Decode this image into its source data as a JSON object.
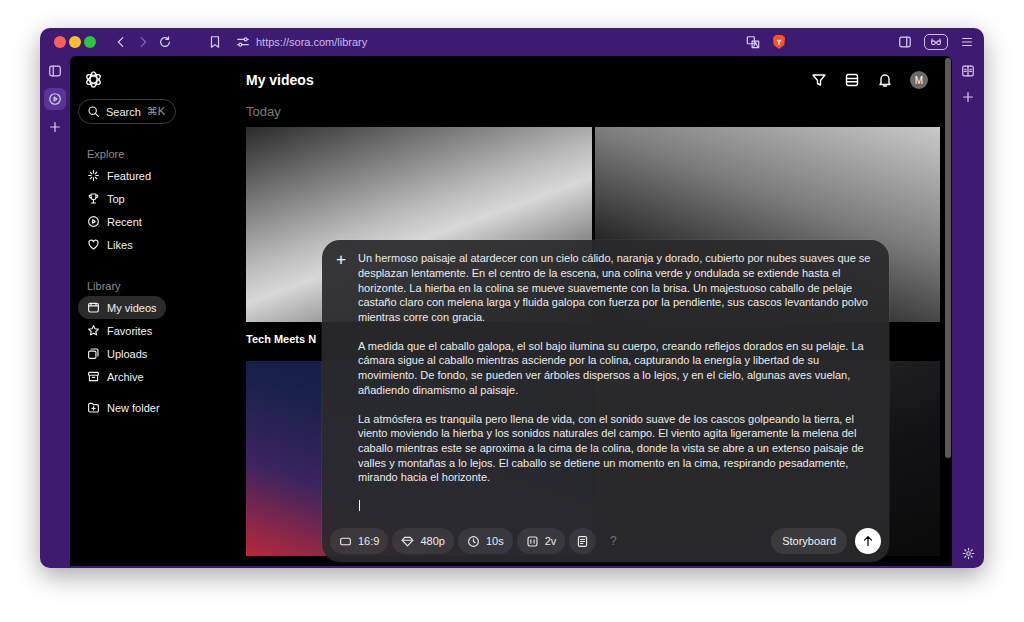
{
  "browser": {
    "url": "https://sora.com/library",
    "pinned_tabs": [
      {
        "selected": true
      }
    ]
  },
  "sidebar": {
    "search": {
      "label": "Search",
      "shortcut": "⌘K"
    },
    "sections": [
      {
        "title": "Explore",
        "items": [
          {
            "label": "Featured",
            "selected": false
          },
          {
            "label": "Top",
            "selected": false
          },
          {
            "label": "Recent",
            "selected": false
          },
          {
            "label": "Likes",
            "selected": false
          }
        ]
      },
      {
        "title": "Library",
        "items": [
          {
            "label": "My videos",
            "selected": true
          },
          {
            "label": "Favorites",
            "selected": false
          },
          {
            "label": "Uploads",
            "selected": false
          },
          {
            "label": "Archive",
            "selected": false
          }
        ]
      }
    ],
    "new_folder": "New folder"
  },
  "header": {
    "title": "My videos",
    "avatar": "M"
  },
  "today": "Today",
  "collection": "Tech Meets N",
  "prompt": {
    "add": "+",
    "paragraphs": [
      "Un hermoso paisaje al atardecer con un cielo cálido, naranja y dorado, cubierto por nubes suaves que se desplazan lentamente. En el centro de la escena, una colina verde y ondulada se extiende hasta el horizonte. La hierba en la colina se mueve suavemente con la brisa. Un majestuoso caballo de pelaje castaño claro con melena larga y fluida galopa con fuerza por la pendiente, sus cascos levantando polvo mientras corre con gracia.",
      "A medida que el caballo galopa, el sol bajo ilumina su cuerpo, creando reflejos dorados en su pelaje. La cámara sigue al caballo mientras asciende por la colina, capturando la energía y libertad de su movimiento. De fondo, se pueden ver árboles dispersos a lo lejos, y en el cielo, algunas aves vuelan, añadiendo dinamismo al paisaje.",
      "La atmósfera es tranquila pero llena de vida, con el sonido suave de los cascos golpeando la tierra, el viento moviendo la hierba y los sonidos naturales del campo. El viento agita ligeramente la melena del caballo mientras este se aproxima a la cima de la colina, donde la vista se abre a un extenso paisaje de valles y montañas a lo lejos. El caballo se detiene un momento en la cima, respirando pesadamente, mirando hacia el horizonte."
    ],
    "options": [
      "16:9",
      "480p",
      "10s",
      "2v"
    ],
    "help": "?",
    "storyboard": "Storyboard"
  }
}
